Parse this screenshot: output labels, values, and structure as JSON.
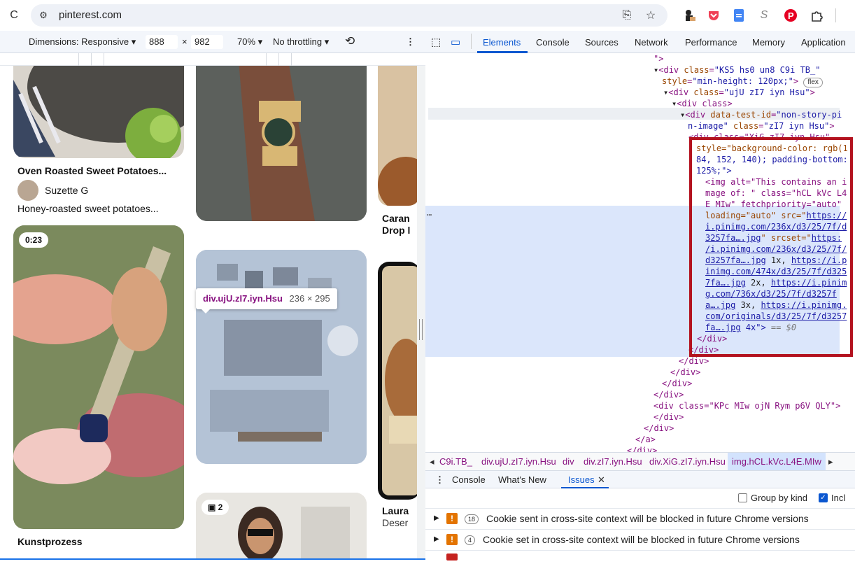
{
  "browser": {
    "url": "pinterest.com",
    "icons": [
      "reload-icon",
      "site-settings-icon",
      "install-app-icon",
      "bookmark-star-icon",
      "extension-figure-icon",
      "pocket-icon",
      "docs-icon",
      "extension-s-icon",
      "pinterest-icon",
      "extensions-puzzle-icon"
    ]
  },
  "device_toolbar": {
    "dimensions_label": "Dimensions: Responsive",
    "width": "888",
    "times": "×",
    "height": "982",
    "zoom": "70%",
    "throttling": "No throttling",
    "more": "⋮"
  },
  "page": {
    "pins": {
      "pin1_title": "Oven Roasted Sweet Potatoes...",
      "pin1_author": "Suzette G",
      "pin1_desc": "Honey-roasted sweet potatoes...",
      "pin2_badge": "0:23",
      "pin2_title": "Kunstprozess",
      "pin3_badge": "2",
      "col3_title1": "Caran",
      "col3_title2": "Drop l",
      "col3_title3": "Laura",
      "col3_desc3": "Deser"
    },
    "tooltip": {
      "selector": "div.ujU.zI7.iyn.Hsu",
      "size": "236 × 295"
    }
  },
  "devtools": {
    "tabs": [
      "Elements",
      "Console",
      "Sources",
      "Network",
      "Performance",
      "Memory",
      "Application"
    ],
    "active_tab": "Elements",
    "code": {
      "l0": "\">",
      "l1_tag": "div",
      "l1_class": "KS5 hs0 un8 C9i TB_",
      "l2_style": "min-height: 120px;",
      "l2_badge": "flex",
      "l3_class": "ujU zI7 iyn Hsu",
      "l4": "<div class>",
      "l5_attr": "data-test-id",
      "l5_val": "non-story-pi",
      "l6_val": "n-image",
      "l6_class": "zI7 iyn Hsu",
      "l7": "<div class=\"XiG zI7 iyn Hsu\"",
      "l8": "style=\"background-color: rgb(1",
      "l9": "84, 152, 140); padding-bottom:",
      "l10": "125%;\">",
      "l11": "<img alt=\"This contains an i",
      "l12": "mage of: \" class=\"hCL kVc L4",
      "l13": "E MIw\" fetchpriority=\"auto\"",
      "l14_a": "loading=\"auto\" src=\"",
      "l14_b": "https://",
      "l15": "i.pinimg.com/236x/d3/25/7f/d",
      "l16_a": "3257fa….jpg",
      "l16_b": "\" srcset=\"",
      "l16_c": "https:",
      "l17": "/i.pinimg.com/236x/d3/25/7f/",
      "l18_a": "d3257fa….jpg",
      "l18_b": " 1x, ",
      "l18_c": "https://i.p",
      "l19": "inimg.com/474x/d3/25/7f/d325",
      "l20_a": "7fa….jpg",
      "l20_b": " 2x, ",
      "l20_c": "https://i.pinim",
      "l21": "g.com/736x/d3/25/7f/d3257f",
      "l22_a": "a….jpg",
      "l22_b": " 3x, ",
      "l22_c": "https://i.pinimg.",
      "l23": "com/originals/d3/25/7f/d3257",
      "l24_a": "fa….jpg",
      "l24_b": " 4x\">",
      "l24_c": " == $0",
      "c1": "</div>",
      "c2": "</div>",
      "c3": "</div>",
      "c4": "</div>",
      "c5": "</div>",
      "c6": "</div>",
      "l_kpc": "<div class=\"KPc MIw ojN Rym p6V QLY\">",
      "c7": "</div>",
      "c8": "</div>",
      "c9": "</a>",
      "c10": "</div>",
      "ellipsis": "…"
    },
    "breadcrumbs": [
      "C9i.TB_",
      "div.ujU.zI7.iyn.Hsu",
      "div",
      "div.zI7.iyn.Hsu",
      "div.XiG.zI7.iyn.Hsu",
      "img.hCL.kVc.L4E.MIw"
    ],
    "drawer_tabs": [
      "Console",
      "What's New",
      "Issues"
    ],
    "drawer_active": "Issues",
    "group_by_kind": "Group by kind",
    "include": "Incl",
    "issues": [
      {
        "count": "18",
        "text": "Cookie sent in cross-site context will be blocked in future Chrome versions"
      },
      {
        "count": "4",
        "text": "Cookie set in cross-site context will be blocked in future Chrome versions"
      }
    ]
  }
}
